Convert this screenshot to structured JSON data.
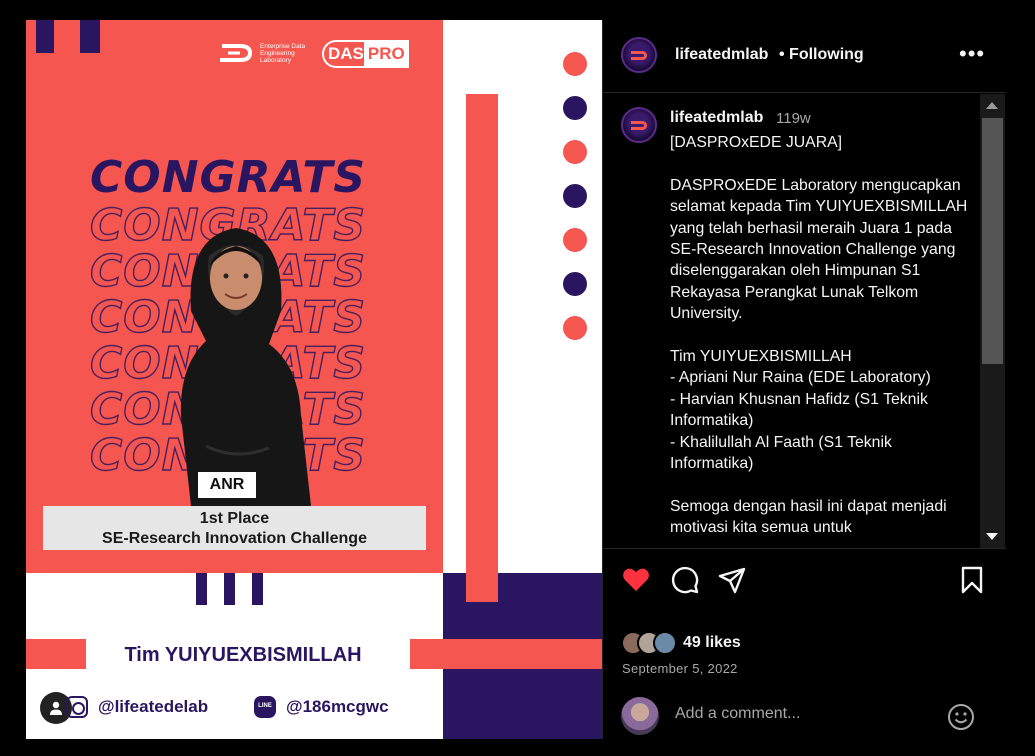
{
  "post_image": {
    "logo_ede_text": "Enterprise Data Engineering Laboratory",
    "logo_daspro_das": "DAS",
    "logo_daspro_pro": "PRO",
    "congrats_word": "CONGRATS",
    "name_tag": "ANR",
    "place_line1": "1st Place",
    "place_line2": "SE-Research Innovation Challenge",
    "team_name": "Tim YUIYUEXBISMILLAH",
    "instagram_handle": "@lifeatedelab",
    "line_handle": "@186mcgwc",
    "colors": {
      "coral": "#f5564f",
      "navy": "#2a1660"
    }
  },
  "header": {
    "username": "lifeatedmlab",
    "follow_status": "• Following",
    "more_icon": "more-horizontal-icon"
  },
  "caption": {
    "username": "lifeatedmlab",
    "time_ago": "119w",
    "text": "[DASPROxEDE JUARA]\n\nDASPROxEDE Laboratory mengucapkan selamat kepada Tim YUIYUEXBISMILLAH yang telah berhasil meraih Juara 1 pada SE-Research Innovation Challenge yang diselenggarakan oleh Himpunan S1 Rekayasa Perangkat Lunak Telkom University.\n\nTim YUIYUEXBISMILLAH\n- Apriani Nur Raina (EDE Laboratory)\n- Harvian Khusnan Hafidz (S1 Teknik Informatika)\n- Khalilullah Al Faath (S1 Teknik Informatika)\n\nSemoga dengan hasil ini dapat menjadi motivasi kita semua untuk"
  },
  "actions": {
    "like_icon": "heart-filled-icon",
    "comment_icon": "comment-icon",
    "share_icon": "send-icon",
    "save_icon": "bookmark-icon",
    "likes": "49 likes",
    "date": "September 5, 2022",
    "like_color": "#ff3040"
  },
  "comment": {
    "placeholder": "Add a comment...",
    "emoji_icon": "emoji-smile-icon"
  }
}
